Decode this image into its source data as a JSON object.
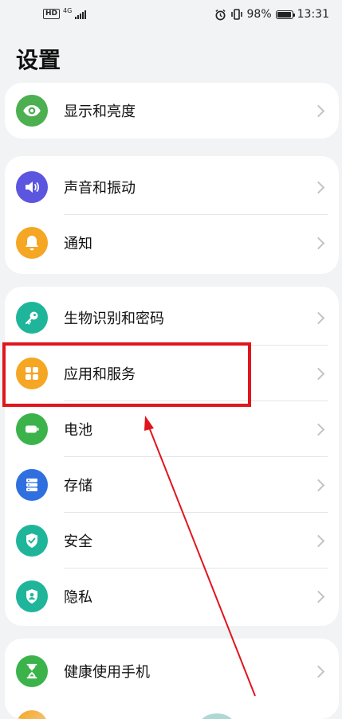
{
  "status_bar": {
    "hd": "HD",
    "network": "4G",
    "battery_percent": "98%",
    "time": "13:31"
  },
  "page": {
    "title": "设置"
  },
  "groups": [
    {
      "items": [
        {
          "label": "显示和亮度",
          "icon": "eye-icon",
          "color": "#4caf50"
        }
      ]
    },
    {
      "items": [
        {
          "label": "声音和振动",
          "icon": "speaker-icon",
          "color": "#5b55e0"
        },
        {
          "label": "通知",
          "icon": "bell-icon",
          "color": "#f5a623"
        }
      ]
    },
    {
      "items": [
        {
          "label": "生物识别和密码",
          "icon": "key-icon",
          "color": "#1fb59a"
        },
        {
          "label": "应用和服务",
          "icon": "apps-icon",
          "color": "#f5a623"
        },
        {
          "label": "电池",
          "icon": "battery-icon",
          "color": "#3bb34a"
        },
        {
          "label": "存储",
          "icon": "storage-icon",
          "color": "#2f6fe0"
        },
        {
          "label": "安全",
          "icon": "shield-check-icon",
          "color": "#1fb59a"
        },
        {
          "label": "隐私",
          "icon": "privacy-icon",
          "color": "#1fb59a"
        }
      ]
    },
    {
      "items": [
        {
          "label": "健康使用手机",
          "icon": "hourglass-icon",
          "color": "#3bb34a"
        }
      ]
    }
  ],
  "annotation": {
    "highlight_color": "#e0161d"
  }
}
